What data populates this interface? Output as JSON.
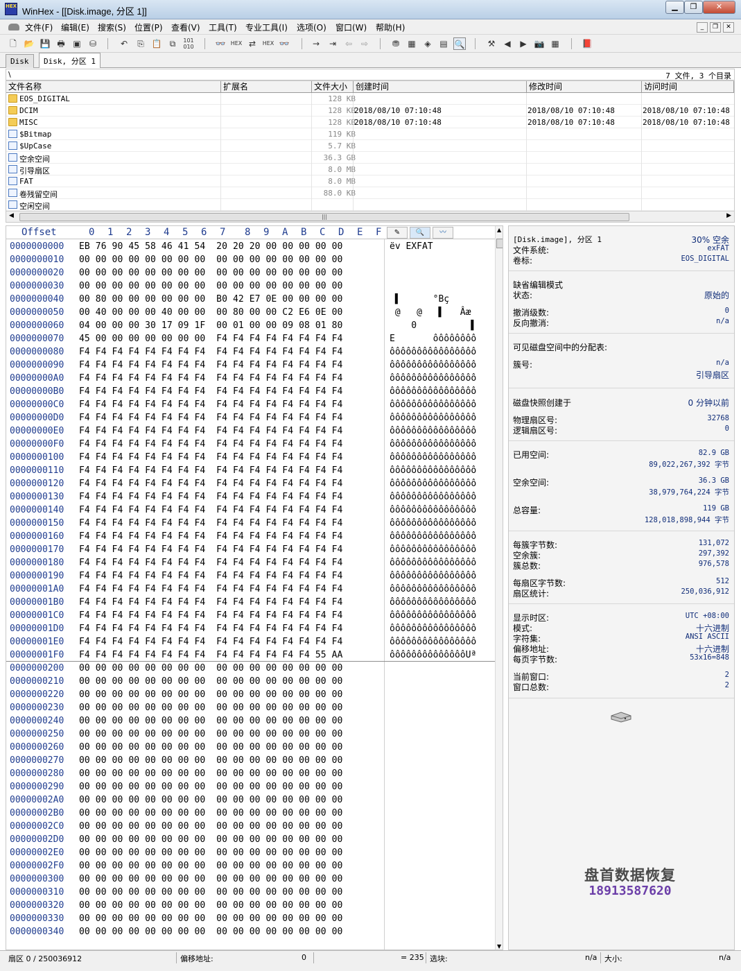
{
  "window": {
    "title": "WinHex - [[Disk.image, 分区 1]]",
    "logo": "HEX",
    "min": "▁",
    "max": "❐",
    "close": "✕"
  },
  "menu": [
    "文件(F)",
    "编辑(E)",
    "搜索(S)",
    "位置(P)",
    "查看(V)",
    "工具(T)",
    "专业工具(I)",
    "选项(O)",
    "窗口(W)",
    "帮助(H)"
  ],
  "mdi": {
    "min": "_",
    "restore": "❐",
    "close": "✕"
  },
  "toolbar_icons": [
    "new-file-icon",
    "open-icon",
    "save-icon",
    "print-icon",
    "properties-icon",
    "open-disk-icon",
    "undo-icon",
    "copy-icon",
    "paste-icon",
    "copy-block-icon",
    "binary-icon",
    "find-text-icon",
    "find-hex-icon",
    "replace-text-icon",
    "replace-hex-icon",
    "find-next-icon",
    "goto-offset-icon",
    "goto-sector-icon",
    "back-icon",
    "forward-icon",
    "disk-editor-icon",
    "ram-editor-icon",
    "hash-icon",
    "calculator-icon",
    "analyze-icon",
    "tools-icon",
    "prev-icon",
    "next-icon",
    "snapshot-icon",
    "grid-icon",
    "help-book-icon"
  ],
  "tabs": [
    "Disk",
    "Disk, 分区 1"
  ],
  "path": "\\",
  "file_count": "7 文件, 3 个目录",
  "columns": [
    "文件名称",
    "扩展名",
    "文件大小",
    "创建时间",
    "修改时间",
    "访问时间"
  ],
  "files": [
    {
      "icon": "folder",
      "name": "EOS_DIGITAL",
      "size": "128 KB",
      "created": "",
      "modified": "",
      "accessed": ""
    },
    {
      "icon": "folder",
      "name": "DCIM",
      "size": "128 KB",
      "created": "2018/08/10  07:10:48",
      "modified": "2018/08/10  07:10:48",
      "accessed": "2018/08/10  07:10:48"
    },
    {
      "icon": "folder",
      "name": "MISC",
      "size": "128 KB",
      "created": "2018/08/10  07:10:48",
      "modified": "2018/08/10  07:10:48",
      "accessed": "2018/08/10  07:10:48"
    },
    {
      "icon": "file",
      "name": "$Bitmap",
      "size": "119 KB",
      "created": "",
      "modified": "",
      "accessed": ""
    },
    {
      "icon": "file",
      "name": "$UpCase",
      "size": "5.7 KB",
      "created": "",
      "modified": "",
      "accessed": ""
    },
    {
      "icon": "file",
      "name": "空余空间",
      "size": "36.3 GB",
      "created": "",
      "modified": "",
      "accessed": ""
    },
    {
      "icon": "file",
      "name": "引导扇区",
      "size": "8.0 MB",
      "created": "",
      "modified": "",
      "accessed": ""
    },
    {
      "icon": "file",
      "name": "FAT",
      "size": "8.0 MB",
      "created": "",
      "modified": "",
      "accessed": ""
    },
    {
      "icon": "file",
      "name": "卷残留空间",
      "size": "88.0 KB",
      "created": "",
      "modified": "",
      "accessed": ""
    },
    {
      "icon": "file",
      "name": "空闲空间",
      "size": "",
      "created": "",
      "modified": "",
      "accessed": ""
    }
  ],
  "hex_header": {
    "offset": "Offset",
    "cols": [
      "0",
      "1",
      "2",
      "3",
      "4",
      "5",
      "6",
      "7",
      "8",
      "9",
      "A",
      "B",
      "C",
      "D",
      "E",
      "F"
    ]
  },
  "text_tools": [
    "pencil-icon",
    "search-icon",
    "wave-icon"
  ],
  "hex_rows": [
    {
      "off": "0000000000",
      "bytes": "EB 76 90 45 58 46 41 54  20 20 20 00 00 00 00 00",
      "text": "ëv EXFAT"
    },
    {
      "off": "0000000010",
      "bytes": "00 00 00 00 00 00 00 00  00 00 00 00 00 00 00 00",
      "text": ""
    },
    {
      "off": "0000000020",
      "bytes": "00 00 00 00 00 00 00 00  00 00 00 00 00 00 00 00",
      "text": ""
    },
    {
      "off": "0000000030",
      "bytes": "00 00 00 00 00 00 00 00  00 00 00 00 00 00 00 00",
      "text": ""
    },
    {
      "off": "0000000040",
      "bytes": "00 80 00 00 00 00 00 00  B0 42 E7 0E 00 00 00 00",
      "text": " ▌      °Bç"
    },
    {
      "off": "0000000050",
      "bytes": "00 40 00 00 00 40 00 00  00 80 00 00 C2 E6 0E 00",
      "text": " @   @   ▌   Âæ"
    },
    {
      "off": "0000000060",
      "bytes": "04 00 00 00 30 17 09 1F  00 01 00 00 09 08 01 80",
      "text": "    0          ▌"
    },
    {
      "off": "0000000070",
      "bytes": "45 00 00 00 00 00 00 00  F4 F4 F4 F4 F4 F4 F4 F4",
      "text": "E       ôôôôôôôô"
    },
    {
      "off": "0000000080",
      "bytes": "F4 F4 F4 F4 F4 F4 F4 F4  F4 F4 F4 F4 F4 F4 F4 F4",
      "text": "ôôôôôôôôôôôôôôôô"
    },
    {
      "off": "0000000090",
      "bytes": "F4 F4 F4 F4 F4 F4 F4 F4  F4 F4 F4 F4 F4 F4 F4 F4",
      "text": "ôôôôôôôôôôôôôôôô"
    },
    {
      "off": "00000000A0",
      "bytes": "F4 F4 F4 F4 F4 F4 F4 F4  F4 F4 F4 F4 F4 F4 F4 F4",
      "text": "ôôôôôôôôôôôôôôôô"
    },
    {
      "off": "00000000B0",
      "bytes": "F4 F4 F4 F4 F4 F4 F4 F4  F4 F4 F4 F4 F4 F4 F4 F4",
      "text": "ôôôôôôôôôôôôôôôô"
    },
    {
      "off": "00000000C0",
      "bytes": "F4 F4 F4 F4 F4 F4 F4 F4  F4 F4 F4 F4 F4 F4 F4 F4",
      "text": "ôôôôôôôôôôôôôôôô"
    },
    {
      "off": "00000000D0",
      "bytes": "F4 F4 F4 F4 F4 F4 F4 F4  F4 F4 F4 F4 F4 F4 F4 F4",
      "text": "ôôôôôôôôôôôôôôôô"
    },
    {
      "off": "00000000E0",
      "bytes": "F4 F4 F4 F4 F4 F4 F4 F4  F4 F4 F4 F4 F4 F4 F4 F4",
      "text": "ôôôôôôôôôôôôôôôô"
    },
    {
      "off": "00000000F0",
      "bytes": "F4 F4 F4 F4 F4 F4 F4 F4  F4 F4 F4 F4 F4 F4 F4 F4",
      "text": "ôôôôôôôôôôôôôôôô"
    },
    {
      "off": "0000000100",
      "bytes": "F4 F4 F4 F4 F4 F4 F4 F4  F4 F4 F4 F4 F4 F4 F4 F4",
      "text": "ôôôôôôôôôôôôôôôô"
    },
    {
      "off": "0000000110",
      "bytes": "F4 F4 F4 F4 F4 F4 F4 F4  F4 F4 F4 F4 F4 F4 F4 F4",
      "text": "ôôôôôôôôôôôôôôôô"
    },
    {
      "off": "0000000120",
      "bytes": "F4 F4 F4 F4 F4 F4 F4 F4  F4 F4 F4 F4 F4 F4 F4 F4",
      "text": "ôôôôôôôôôôôôôôôô"
    },
    {
      "off": "0000000130",
      "bytes": "F4 F4 F4 F4 F4 F4 F4 F4  F4 F4 F4 F4 F4 F4 F4 F4",
      "text": "ôôôôôôôôôôôôôôôô"
    },
    {
      "off": "0000000140",
      "bytes": "F4 F4 F4 F4 F4 F4 F4 F4  F4 F4 F4 F4 F4 F4 F4 F4",
      "text": "ôôôôôôôôôôôôôôôô"
    },
    {
      "off": "0000000150",
      "bytes": "F4 F4 F4 F4 F4 F4 F4 F4  F4 F4 F4 F4 F4 F4 F4 F4",
      "text": "ôôôôôôôôôôôôôôôô"
    },
    {
      "off": "0000000160",
      "bytes": "F4 F4 F4 F4 F4 F4 F4 F4  F4 F4 F4 F4 F4 F4 F4 F4",
      "text": "ôôôôôôôôôôôôôôôô"
    },
    {
      "off": "0000000170",
      "bytes": "F4 F4 F4 F4 F4 F4 F4 F4  F4 F4 F4 F4 F4 F4 F4 F4",
      "text": "ôôôôôôôôôôôôôôôô"
    },
    {
      "off": "0000000180",
      "bytes": "F4 F4 F4 F4 F4 F4 F4 F4  F4 F4 F4 F4 F4 F4 F4 F4",
      "text": "ôôôôôôôôôôôôôôôô"
    },
    {
      "off": "0000000190",
      "bytes": "F4 F4 F4 F4 F4 F4 F4 F4  F4 F4 F4 F4 F4 F4 F4 F4",
      "text": "ôôôôôôôôôôôôôôôô"
    },
    {
      "off": "00000001A0",
      "bytes": "F4 F4 F4 F4 F4 F4 F4 F4  F4 F4 F4 F4 F4 F4 F4 F4",
      "text": "ôôôôôôôôôôôôôôôô"
    },
    {
      "off": "00000001B0",
      "bytes": "F4 F4 F4 F4 F4 F4 F4 F4  F4 F4 F4 F4 F4 F4 F4 F4",
      "text": "ôôôôôôôôôôôôôôôô"
    },
    {
      "off": "00000001C0",
      "bytes": "F4 F4 F4 F4 F4 F4 F4 F4  F4 F4 F4 F4 F4 F4 F4 F4",
      "text": "ôôôôôôôôôôôôôôôô"
    },
    {
      "off": "00000001D0",
      "bytes": "F4 F4 F4 F4 F4 F4 F4 F4  F4 F4 F4 F4 F4 F4 F4 F4",
      "text": "ôôôôôôôôôôôôôôôô"
    },
    {
      "off": "00000001E0",
      "bytes": "F4 F4 F4 F4 F4 F4 F4 F4  F4 F4 F4 F4 F4 F4 F4 F4",
      "text": "ôôôôôôôôôôôôôôôô"
    },
    {
      "off": "00000001F0",
      "bytes": "F4 F4 F4 F4 F4 F4 F4 F4  F4 F4 F4 F4 F4 F4 55 AA",
      "text": "ôôôôôôôôôôôôôôUª"
    },
    {
      "off": "0000000200",
      "bytes": "00 00 00 00 00 00 00 00  00 00 00 00 00 00 00 00",
      "text": ""
    },
    {
      "off": "0000000210",
      "bytes": "00 00 00 00 00 00 00 00  00 00 00 00 00 00 00 00",
      "text": ""
    },
    {
      "off": "0000000220",
      "bytes": "00 00 00 00 00 00 00 00  00 00 00 00 00 00 00 00",
      "text": ""
    },
    {
      "off": "0000000230",
      "bytes": "00 00 00 00 00 00 00 00  00 00 00 00 00 00 00 00",
      "text": ""
    },
    {
      "off": "0000000240",
      "bytes": "00 00 00 00 00 00 00 00  00 00 00 00 00 00 00 00",
      "text": ""
    },
    {
      "off": "0000000250",
      "bytes": "00 00 00 00 00 00 00 00  00 00 00 00 00 00 00 00",
      "text": ""
    },
    {
      "off": "0000000260",
      "bytes": "00 00 00 00 00 00 00 00  00 00 00 00 00 00 00 00",
      "text": ""
    },
    {
      "off": "0000000270",
      "bytes": "00 00 00 00 00 00 00 00  00 00 00 00 00 00 00 00",
      "text": ""
    },
    {
      "off": "0000000280",
      "bytes": "00 00 00 00 00 00 00 00  00 00 00 00 00 00 00 00",
      "text": ""
    },
    {
      "off": "0000000290",
      "bytes": "00 00 00 00 00 00 00 00  00 00 00 00 00 00 00 00",
      "text": ""
    },
    {
      "off": "00000002A0",
      "bytes": "00 00 00 00 00 00 00 00  00 00 00 00 00 00 00 00",
      "text": ""
    },
    {
      "off": "00000002B0",
      "bytes": "00 00 00 00 00 00 00 00  00 00 00 00 00 00 00 00",
      "text": ""
    },
    {
      "off": "00000002C0",
      "bytes": "00 00 00 00 00 00 00 00  00 00 00 00 00 00 00 00",
      "text": ""
    },
    {
      "off": "00000002D0",
      "bytes": "00 00 00 00 00 00 00 00  00 00 00 00 00 00 00 00",
      "text": ""
    },
    {
      "off": "00000002E0",
      "bytes": "00 00 00 00 00 00 00 00  00 00 00 00 00 00 00 00",
      "text": ""
    },
    {
      "off": "00000002F0",
      "bytes": "00 00 00 00 00 00 00 00  00 00 00 00 00 00 00 00",
      "text": ""
    },
    {
      "off": "0000000300",
      "bytes": "00 00 00 00 00 00 00 00  00 00 00 00 00 00 00 00",
      "text": ""
    },
    {
      "off": "0000000310",
      "bytes": "00 00 00 00 00 00 00 00  00 00 00 00 00 00 00 00",
      "text": ""
    },
    {
      "off": "0000000320",
      "bytes": "00 00 00 00 00 00 00 00  00 00 00 00 00 00 00 00",
      "text": ""
    },
    {
      "off": "0000000330",
      "bytes": "00 00 00 00 00 00 00 00  00 00 00 00 00 00 00 00",
      "text": ""
    },
    {
      "off": "0000000340",
      "bytes": "00 00 00 00 00 00 00 00  00 00 00 00 00 00 00 00",
      "text": ""
    }
  ],
  "info": {
    "source": "[Disk.image], 分区 1",
    "free_pct": "30% 空余",
    "fs_label": "文件系统:",
    "fs": "exFAT",
    "vol_label": "卷标:",
    "vol": "EOS_DIGITAL",
    "edit_mode_title": "缺省编辑模式",
    "state_label": "状态:",
    "state": "原始的",
    "undo_level_label": "撤消级数:",
    "undo_level": "0",
    "reverse_undo_label": "反向撤消:",
    "reverse_undo": "n/a",
    "alloc_title": "可见磁盘空间中的分配表:",
    "cluster_label": "簇号:",
    "cluster": "n/a",
    "cluster_region": "引导扇区",
    "snapshot_label": "磁盘快照创建于",
    "snapshot": "0 分钟以前",
    "phys_sector_label": "物理扇区号:",
    "phys_sector": "32768",
    "log_sector_label": "逻辑扇区号:",
    "log_sector": "0",
    "used_label": "已用空间:",
    "used_gb": "82.9 GB",
    "used_bytes": "89,022,267,392 字节",
    "free_label": "空余空间:",
    "free_gb": "36.3 GB",
    "free_bytes": "38,979,764,224 字节",
    "total_label": "总容量:",
    "total_gb": "119 GB",
    "total_bytes": "128,018,898,944 字节",
    "bpc_label": "每簇字节数:",
    "bpc": "131,072",
    "free_clusters_label": "空余簇:",
    "free_clusters": "297,392",
    "total_clusters_label": "簇总数:",
    "total_clusters": "976,578",
    "bps_label": "每扇区字节数:",
    "bps": "512",
    "sector_count_label": "扇区统计:",
    "sector_count": "250,036,912",
    "tz_label": "显示时区:",
    "tz": "UTC +08:00",
    "mode_label": "模式:",
    "mode": "十六进制",
    "charset_label": "字符集:",
    "charset": "ANSI ASCII",
    "offsets_label": "偏移地址:",
    "offsets": "十六进制",
    "bpp_label": "每页字节数:",
    "bpp": "53x16=848",
    "cur_win_label": "当前窗口:",
    "cur_win": "2",
    "total_win_label": "窗口总数:",
    "total_win": "2",
    "watermark_name": "盘首数据恢复",
    "watermark_phone": "18913587620"
  },
  "status": {
    "sector": "扇区 0 / 250036912",
    "offset_label": "偏移地址:",
    "offset": "0",
    "value": "= 235",
    "block_label": "选块:",
    "block": "n/a",
    "size_label": "大小:",
    "size": "n/a"
  }
}
